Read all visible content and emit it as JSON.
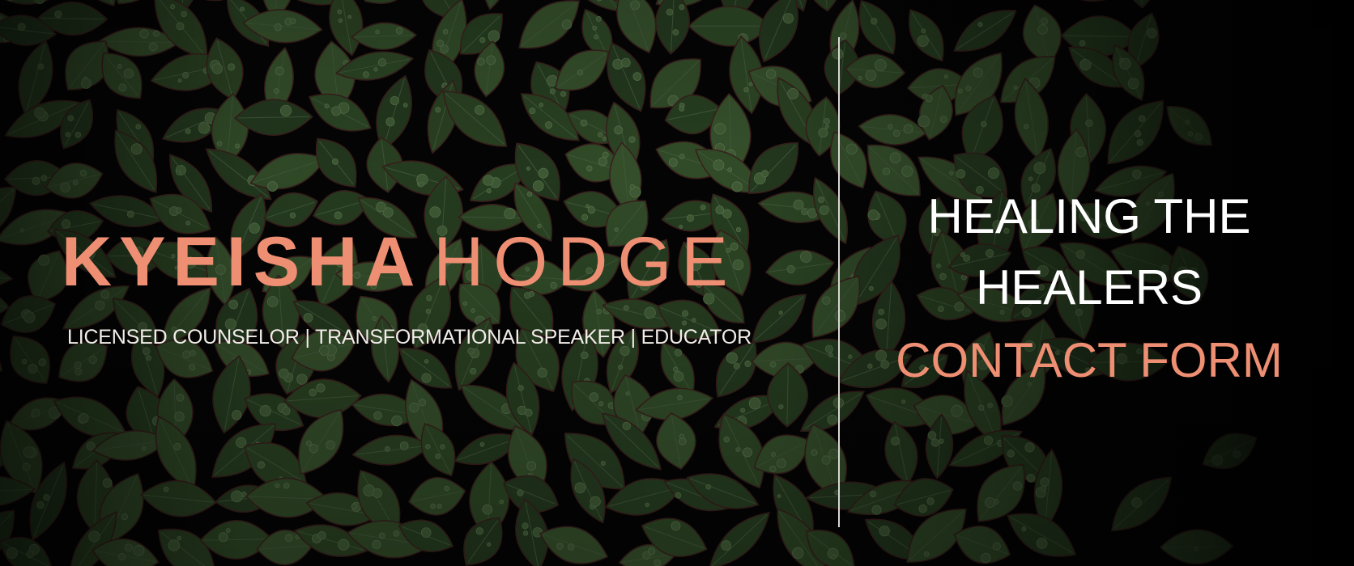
{
  "brand": {
    "first_name": "KYEISHA",
    "last_name": "HODGE",
    "tagline": "LICENSED COUNSELOR | TRANSFORMATIONAL SPEAKER | EDUCATOR"
  },
  "hero": {
    "heading_line1": "HEALING THE",
    "heading_line2": "HEALERS",
    "cta_label": "CONTACT FORM"
  },
  "colors": {
    "accent": "#ee8f73",
    "text": "#ffffff",
    "background": "#050505",
    "leaf": "#2c4524"
  },
  "background_image": "dark green leaves with water droplets"
}
